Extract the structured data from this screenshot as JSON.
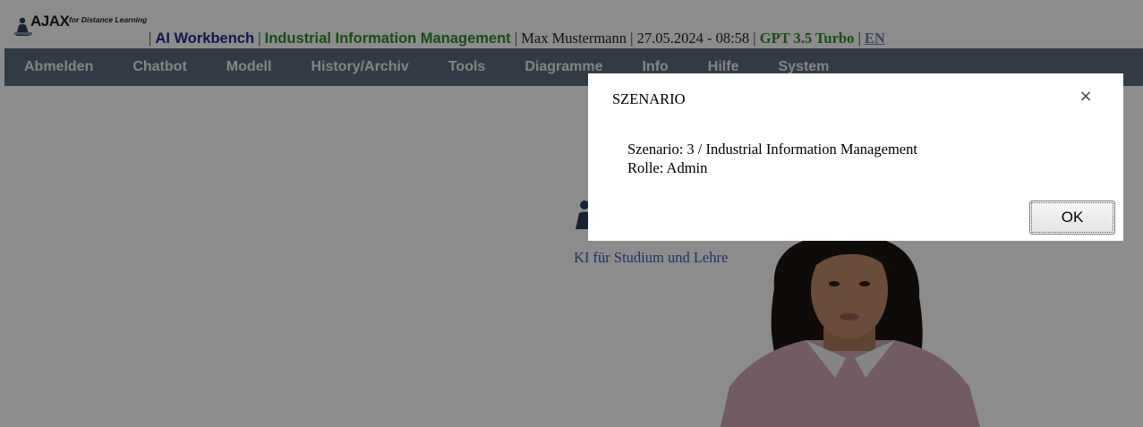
{
  "header": {
    "logo_text": "AJAX",
    "logo_tagline": "for Distance Learning",
    "app_name": "AI Workbench",
    "scenario_name": "Industrial Information Management",
    "user_name": "Max Mustermann",
    "datetime": "27.05.2024 - 08:58",
    "model": "GPT 3.5 Turbo",
    "language_link": "EN",
    "separator": "|"
  },
  "nav": {
    "items": [
      {
        "label": "Abmelden"
      },
      {
        "label": "Chatbot"
      },
      {
        "label": "Modell"
      },
      {
        "label": "History/Archiv"
      },
      {
        "label": "Tools"
      },
      {
        "label": "Diagramme"
      },
      {
        "label": "Info"
      },
      {
        "label": "Hilfe"
      },
      {
        "label": "System"
      }
    ]
  },
  "content": {
    "tagline": "KI für Studium und Lehre"
  },
  "dialog": {
    "title": "SZENARIO",
    "close_symbol": "×",
    "line1": "Szenario: 3 / Industrial Information Management",
    "line2": "Rolle: Admin",
    "ok_label": "OK"
  },
  "colors": {
    "nav_bg": "#5b6c7e",
    "app_name": "#1c2a8c",
    "scenario": "#2a8a2a",
    "tagline": "#3c5bb5"
  },
  "icons": [
    "person-logo-icon",
    "close-icon"
  ]
}
